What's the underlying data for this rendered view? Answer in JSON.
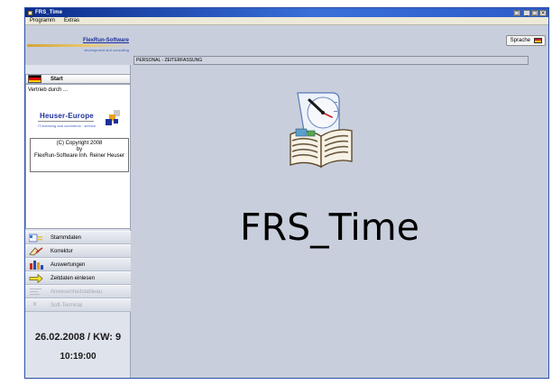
{
  "window": {
    "title": "FRS_Time",
    "controls": {
      "minimize": "_",
      "restore": "□",
      "close": "×"
    }
  },
  "menu": [
    "Programm",
    "Extras"
  ],
  "brand": {
    "name": "FlexRun-Software",
    "tagline": "development and consulting"
  },
  "sidebar": {
    "start_label": "Start",
    "distributor_intro": "Vertrieb durch ...",
    "distributor": {
      "name": "Heuser-Europe",
      "tagline": "IT-licensing and commerce · service"
    },
    "copyright": [
      "(C) Copyright 2008",
      "by",
      "FlexRun-Software Inh. Reiner Heuser"
    ],
    "nav_items": [
      {
        "label": "Stammdaten",
        "icon": "database-icon",
        "enabled": true
      },
      {
        "label": "Korrektur",
        "icon": "correction-icon",
        "enabled": true
      },
      {
        "label": "Auswertungen",
        "icon": "reports-icon",
        "enabled": true
      },
      {
        "label": "Zeitdaten einlesen",
        "icon": "import-arrow-icon",
        "enabled": true
      },
      {
        "label": "Anwesenheitstableau",
        "icon": "presence-board-icon",
        "enabled": false
      },
      {
        "label": "Soft-Terminal",
        "icon": "terminal-icon",
        "enabled": false
      }
    ],
    "date_week": "26.02.2008 / KW: 9",
    "time": "10:19:00"
  },
  "main": {
    "language_button": "Sprache",
    "breadcrumb": "PERSONAL - ZEITERFASSUNG",
    "app_title": "FRS_Time"
  },
  "colors": {
    "title_bar": "#0a2c8a",
    "workspace": "#c8cedb",
    "brand_blue": "#1d2f9a"
  }
}
